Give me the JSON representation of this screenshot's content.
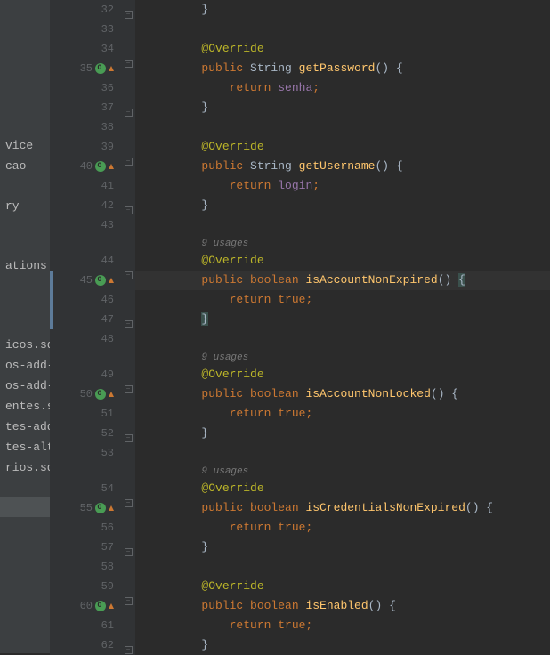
{
  "sidebar": {
    "items": [
      "vice",
      "cao",
      "",
      "ry",
      "",
      "",
      "ations",
      "",
      "",
      "",
      "icos.sql",
      "os-add-co...",
      "os-add-co...",
      "entes.sql",
      "tes-add-c...",
      "tes-altera...",
      "rios.sql"
    ]
  },
  "code": {
    "lines": [
      {
        "n": "32",
        "indent": 2,
        "tokens": [
          {
            "t": "}",
            "c": "k-brace"
          }
        ],
        "fold": "end"
      },
      {
        "n": "33",
        "indent": 0,
        "tokens": []
      },
      {
        "n": "34",
        "indent": 2,
        "tokens": [
          {
            "t": "@Override",
            "c": "k-annotation"
          }
        ]
      },
      {
        "n": "35",
        "indent": 2,
        "icons": [
          "override",
          "up"
        ],
        "fold": "start",
        "tokens": [
          {
            "t": "public ",
            "c": "k-keyword"
          },
          {
            "t": "String ",
            "c": "k-type"
          },
          {
            "t": "getPassword",
            "c": "k-method"
          },
          {
            "t": "() {",
            "c": "k-default"
          }
        ]
      },
      {
        "n": "36",
        "indent": 3,
        "tokens": [
          {
            "t": "return ",
            "c": "k-keyword"
          },
          {
            "t": "senha",
            "c": "k-field"
          },
          {
            "t": ";",
            "c": "k-semi"
          }
        ]
      },
      {
        "n": "37",
        "indent": 2,
        "fold": "end",
        "tokens": [
          {
            "t": "}",
            "c": "k-brace"
          }
        ]
      },
      {
        "n": "38",
        "indent": 0,
        "tokens": []
      },
      {
        "n": "39",
        "indent": 2,
        "tokens": [
          {
            "t": "@Override",
            "c": "k-annotation"
          }
        ]
      },
      {
        "n": "40",
        "indent": 2,
        "icons": [
          "override",
          "up"
        ],
        "fold": "start",
        "tokens": [
          {
            "t": "public ",
            "c": "k-keyword"
          },
          {
            "t": "String ",
            "c": "k-type"
          },
          {
            "t": "getUsername",
            "c": "k-method"
          },
          {
            "t": "() {",
            "c": "k-default"
          }
        ]
      },
      {
        "n": "41",
        "indent": 3,
        "tokens": [
          {
            "t": "return ",
            "c": "k-keyword"
          },
          {
            "t": "login",
            "c": "k-field"
          },
          {
            "t": ";",
            "c": "k-semi"
          }
        ]
      },
      {
        "n": "42",
        "indent": 2,
        "fold": "end",
        "tokens": [
          {
            "t": "}",
            "c": "k-brace"
          }
        ]
      },
      {
        "n": "43",
        "indent": 0,
        "tokens": []
      },
      {
        "n": "",
        "indent": 2,
        "hint": "9 usages",
        "tokens": []
      },
      {
        "n": "44",
        "indent": 2,
        "tokens": [
          {
            "t": "@Override",
            "c": "k-annotation"
          }
        ]
      },
      {
        "n": "45",
        "indent": 2,
        "icons": [
          "override",
          "up"
        ],
        "fold": "start",
        "highlight": true,
        "changebar": true,
        "tokens": [
          {
            "t": "public ",
            "c": "k-keyword"
          },
          {
            "t": "boolean ",
            "c": "k-keyword"
          },
          {
            "t": "isAccountNonExpired",
            "c": "k-method"
          },
          {
            "t": "() ",
            "c": "k-default"
          },
          {
            "t": "{",
            "c": "k-brace hl"
          }
        ]
      },
      {
        "n": "46",
        "indent": 3,
        "changebar": true,
        "tokens": [
          {
            "t": "return ",
            "c": "k-keyword"
          },
          {
            "t": "true",
            "c": "k-keyword"
          },
          {
            "t": ";",
            "c": "k-semi"
          }
        ]
      },
      {
        "n": "47",
        "indent": 2,
        "fold": "end",
        "changebar": true,
        "tokens": [
          {
            "t": "}",
            "c": "k-brace hl"
          }
        ]
      },
      {
        "n": "48",
        "indent": 0,
        "tokens": []
      },
      {
        "n": "",
        "indent": 2,
        "hint": "9 usages",
        "tokens": []
      },
      {
        "n": "49",
        "indent": 2,
        "tokens": [
          {
            "t": "@Override",
            "c": "k-annotation"
          }
        ]
      },
      {
        "n": "50",
        "indent": 2,
        "icons": [
          "override",
          "up"
        ],
        "fold": "start",
        "tokens": [
          {
            "t": "public ",
            "c": "k-keyword"
          },
          {
            "t": "boolean ",
            "c": "k-keyword"
          },
          {
            "t": "isAccountNonLocked",
            "c": "k-method"
          },
          {
            "t": "() {",
            "c": "k-default"
          }
        ]
      },
      {
        "n": "51",
        "indent": 3,
        "tokens": [
          {
            "t": "return ",
            "c": "k-keyword"
          },
          {
            "t": "true",
            "c": "k-keyword"
          },
          {
            "t": ";",
            "c": "k-semi"
          }
        ]
      },
      {
        "n": "52",
        "indent": 2,
        "fold": "end",
        "tokens": [
          {
            "t": "}",
            "c": "k-brace"
          }
        ]
      },
      {
        "n": "53",
        "indent": 0,
        "tokens": []
      },
      {
        "n": "",
        "indent": 2,
        "hint": "9 usages",
        "tokens": []
      },
      {
        "n": "54",
        "indent": 2,
        "tokens": [
          {
            "t": "@Override",
            "c": "k-annotation"
          }
        ]
      },
      {
        "n": "55",
        "indent": 2,
        "icons": [
          "override",
          "up"
        ],
        "fold": "start",
        "tokens": [
          {
            "t": "public ",
            "c": "k-keyword"
          },
          {
            "t": "boolean ",
            "c": "k-keyword"
          },
          {
            "t": "isCredentialsNonExpired",
            "c": "k-method"
          },
          {
            "t": "() {",
            "c": "k-default"
          }
        ]
      },
      {
        "n": "56",
        "indent": 3,
        "tokens": [
          {
            "t": "return ",
            "c": "k-keyword"
          },
          {
            "t": "true",
            "c": "k-keyword"
          },
          {
            "t": ";",
            "c": "k-semi"
          }
        ]
      },
      {
        "n": "57",
        "indent": 2,
        "fold": "end",
        "tokens": [
          {
            "t": "}",
            "c": "k-brace"
          }
        ]
      },
      {
        "n": "58",
        "indent": 0,
        "tokens": []
      },
      {
        "n": "59",
        "indent": 2,
        "tokens": [
          {
            "t": "@Override",
            "c": "k-annotation"
          }
        ]
      },
      {
        "n": "60",
        "indent": 2,
        "icons": [
          "override",
          "up"
        ],
        "fold": "start",
        "tokens": [
          {
            "t": "public ",
            "c": "k-keyword"
          },
          {
            "t": "boolean ",
            "c": "k-keyword"
          },
          {
            "t": "isEnabled",
            "c": "k-method"
          },
          {
            "t": "() {",
            "c": "k-default"
          }
        ]
      },
      {
        "n": "61",
        "indent": 3,
        "tokens": [
          {
            "t": "return ",
            "c": "k-keyword"
          },
          {
            "t": "true",
            "c": "k-keyword"
          },
          {
            "t": ";",
            "c": "k-semi"
          }
        ]
      },
      {
        "n": "62",
        "indent": 2,
        "fold": "end",
        "tokens": [
          {
            "t": "}",
            "c": "k-brace"
          }
        ]
      }
    ]
  }
}
